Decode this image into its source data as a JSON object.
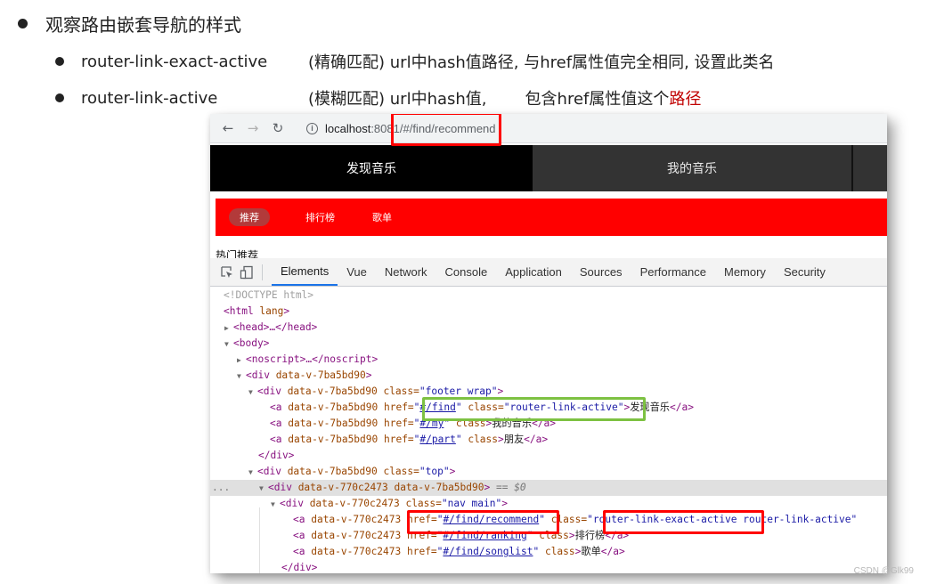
{
  "slide": {
    "heading": "观察路由嵌套导航的样式",
    "bullets": [
      {
        "term": "router-link-exact-active",
        "desc": "(精确匹配) url中hash值路径, 与href属性值完全相同, 设置此类名",
        "desc_red": ""
      },
      {
        "term": "router-link-active",
        "desc_a": "(模糊匹配) url中hash值,",
        "desc_b": "包含href属性值这个",
        "desc_red": "路径"
      }
    ]
  },
  "browser": {
    "back_icon": "arrow-left",
    "forward_icon": "arrow-right",
    "reload_icon": "reload",
    "info_icon": "info-circle",
    "url_host": "localhost",
    "url_port": ":8081",
    "url_path": "/#/find/recommend"
  },
  "app": {
    "top_nav": [
      {
        "label": "发现音乐",
        "active": true
      },
      {
        "label": "我的音乐",
        "active": false
      }
    ],
    "sub_nav": [
      {
        "label": "推荐",
        "active": true
      },
      {
        "label": "排行榜",
        "active": false
      },
      {
        "label": "歌单",
        "active": false
      }
    ],
    "section_title": "热门推荐",
    "colors": {
      "top_active": "#000000",
      "top_bg": "#333333",
      "sub_bg": "#ff0000",
      "sub_active": "#b33a3a"
    }
  },
  "devtools": {
    "tabs": [
      "Elements",
      "Vue",
      "Network",
      "Console",
      "Application",
      "Sources",
      "Performance",
      "Memory",
      "Security"
    ],
    "active_tab": "Elements",
    "lines": {
      "doctype": "<!DOCTYPE html>",
      "html_open": "<html lang>",
      "head": "<head>…</head>",
      "body_open": "<body>",
      "noscript": "<noscript>…</noscript>",
      "div_root": {
        "tag": "<div",
        "attr": " data-v-7ba5bd90",
        "close": ">"
      },
      "footer_wrap": {
        "tag": "<div",
        "attr": " data-v-7ba5bd90 class=",
        "val": "\"footer wrap\"",
        "close": ">"
      },
      "links_footer": [
        {
          "attr": " data-v-7ba5bd90 href=",
          "href": "#/find",
          "cls_attr": " class=",
          "cls_val": "\"router-link-active\"",
          "text": "发现音乐"
        },
        {
          "attr": " data-v-7ba5bd90 href=",
          "href": "#/my",
          "cls_attr": " class",
          "cls_val": "",
          "text": "我的音乐"
        },
        {
          "attr": " data-v-7ba5bd90 href=",
          "href": "#/part",
          "cls_attr": " class",
          "cls_val": "",
          "text": "朋友"
        }
      ],
      "div_close": "</div>",
      "top": {
        "tag": "<div",
        "attr": " data-v-7ba5bd90 class=",
        "val": "\"top\"",
        "close": ">"
      },
      "selected": {
        "tag": "<div",
        "attr": " data-v-770c2473 data-v-7ba5bd90",
        "close": ">",
        "eq": " == $0"
      },
      "nav_main": {
        "tag": "<div",
        "attr": " data-v-770c2473 class=",
        "val": "\"nav main\"",
        "close": ">"
      },
      "links_nav": [
        {
          "attr": " data-v-770c2473 ",
          "href_attr": "href=",
          "href": "#/find/recommend",
          "cls_attr": " class=",
          "cls_val_a": "router-link-exact-active",
          "cls_val_b": " router-link-active\"",
          "text": ""
        },
        {
          "attr": " data-v-770c2473 href=",
          "href": "#/find/ranking",
          "cls_attr": " class",
          "text": "排行榜"
        },
        {
          "attr": " data-v-770c2473 href=",
          "href": "#/find/songlist",
          "cls_attr": " class",
          "text": "歌单"
        }
      ],
      "div_close2": "</div>",
      "ellipsis": "..."
    }
  },
  "watermark": "CSDN @Glk99"
}
